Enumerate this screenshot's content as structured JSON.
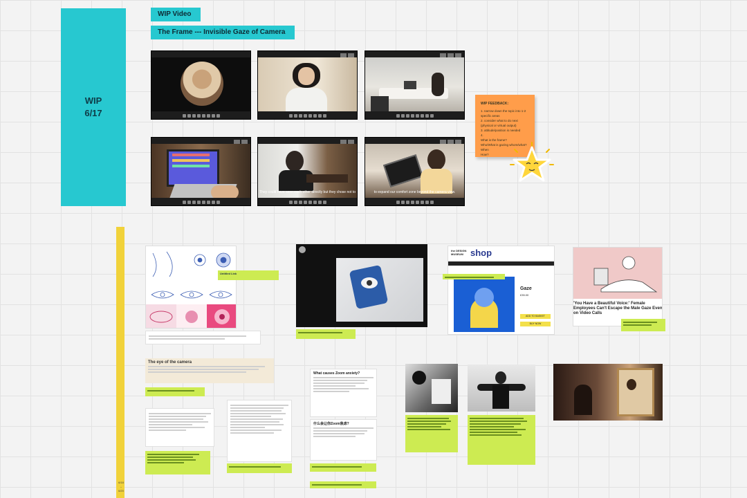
{
  "board": {
    "wip_title": "WIP",
    "wip_date": "6/17",
    "tag_video": "WIP Video",
    "tag_frame": "The Frame --- Invisible Gaze of Camera"
  },
  "frames": {
    "caption_5": "They could have seen each other directly but they chose not to",
    "caption_6": "to expand our comfort zone beyond the camera view."
  },
  "sticky": {
    "heading": "WIP FEEDBACK:",
    "lines": [
      "1. narrow down the topic into 1-2 specific areas",
      "2. consider what to do next (physical or virtual output)",
      "3. attitude/position is needed",
      "4.",
      "What is the frame?",
      "Who/What is gazing whom/what?",
      "When",
      "How?"
    ]
  },
  "research": {
    "link_box_1_title": "Untitled Link",
    "link_box_3_title": "the DESIGN MUSEUM",
    "shop_word": "shop",
    "product_title": "Gaze",
    "product_price": "£35.00",
    "add_basket": "ADD TO BASKET",
    "buy_now": "BUY NOW",
    "article_title": "'You Have a Beautiful Voice:' Female Employees Can't Escape the Male Gaze Even on Video Calls",
    "eye_title": "The eye of the camera",
    "what_title": "What causes Zoom anxiety?",
    "zh_title": "什么会让你Zoom焦虑?"
  },
  "side_label": {
    "line1": "6/18",
    "line2": "–",
    "line3": "6/20"
  }
}
